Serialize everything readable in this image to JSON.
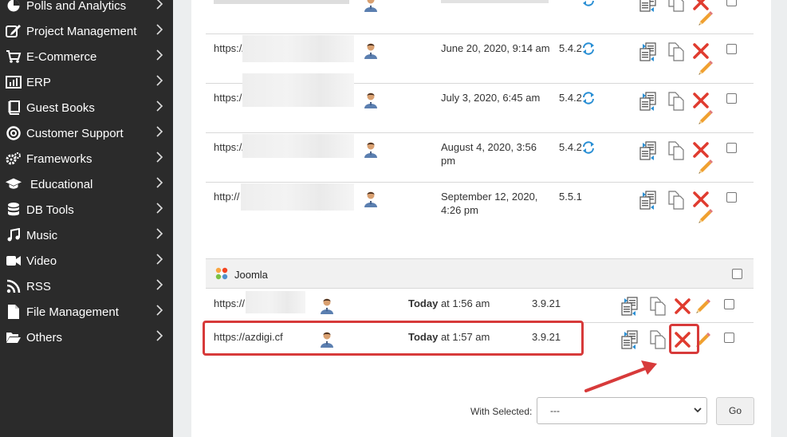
{
  "sidebar": {
    "items": [
      {
        "label": "Polls and Analytics",
        "icon": "chart-pie-icon"
      },
      {
        "label": "Project Management",
        "icon": "edit-icon"
      },
      {
        "label": "E-Commerce",
        "icon": "cart-icon"
      },
      {
        "label": "ERP",
        "icon": "bar-chart-icon"
      },
      {
        "label": "Guest Books",
        "icon": "book-icon"
      },
      {
        "label": "Customer Support",
        "icon": "lifebuoy-icon"
      },
      {
        "label": "Frameworks",
        "icon": "gears-icon"
      },
      {
        "label": "Educational",
        "icon": "graduation-cap-icon"
      },
      {
        "label": "DB Tools",
        "icon": "database-icon"
      },
      {
        "label": "Music",
        "icon": "music-icon"
      },
      {
        "label": "Video",
        "icon": "video-camera-icon"
      },
      {
        "label": "RSS",
        "icon": "rss-icon"
      },
      {
        "label": "File Management",
        "icon": "file-icon"
      },
      {
        "label": "Others",
        "icon": "folder-open-icon"
      }
    ]
  },
  "wordpress_rows": [
    {
      "url": "https://",
      "date": "June 20, 2020, 9:14 am",
      "date2": "",
      "version": "5.4.2",
      "upgrade": true
    },
    {
      "url": "https:/",
      "date": "July 3, 2020, 6:45 am",
      "date2": "",
      "version": "5.4.2",
      "upgrade": true
    },
    {
      "url": "https://",
      "date": "August 4, 2020, 3:56",
      "date2": "pm",
      "version": "5.4.2",
      "upgrade": true
    },
    {
      "url": "http://",
      "date": "September 12, 2020,",
      "date2": "4:26 pm",
      "version": "5.5.1",
      "upgrade": false
    }
  ],
  "joomla": {
    "title": "Joomla",
    "rows": [
      {
        "url": "https://",
        "date_bold": "Today",
        "date_rest": " at 1:56 am",
        "version": "3.9.21"
      },
      {
        "url": "https://azdigi.cf",
        "date_bold": "Today",
        "date_rest": " at 1:57 am",
        "version": "3.9.21"
      }
    ]
  },
  "footer": {
    "with_selected_label": "With Selected:",
    "select_value": "---",
    "go_label": "Go"
  },
  "colors": {
    "sidebar_bg": "#2b2b2b",
    "highlight": "#d73a3a",
    "delete_x": "#e03b2f",
    "pencil": "#f0a030",
    "user_icon": "#5b7fb0",
    "upgrade_arrow": "#2a8fd4"
  }
}
